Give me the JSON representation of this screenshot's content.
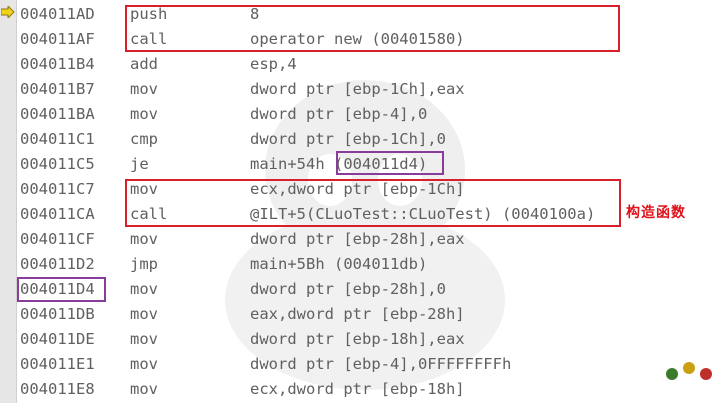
{
  "disassembly": {
    "rows": [
      {
        "addr": "004011AD",
        "op": "push",
        "args": "8"
      },
      {
        "addr": "004011AF",
        "op": "call",
        "args": "operator new (00401580)"
      },
      {
        "addr": "004011B4",
        "op": "add",
        "args": "esp,4"
      },
      {
        "addr": "004011B7",
        "op": "mov",
        "args": "dword ptr [ebp-1Ch],eax"
      },
      {
        "addr": "004011BA",
        "op": "mov",
        "args": "dword ptr [ebp-4],0"
      },
      {
        "addr": "004011C1",
        "op": "cmp",
        "args": "dword ptr [ebp-1Ch],0"
      },
      {
        "addr": "004011C5",
        "op": "je",
        "args": "main+54h (004011d4)"
      },
      {
        "addr": "004011C7",
        "op": "mov",
        "args": "ecx,dword ptr [ebp-1Ch]"
      },
      {
        "addr": "004011CA",
        "op": "call",
        "args": "@ILT+5(CLuoTest::CLuoTest) (0040100a)"
      },
      {
        "addr": "004011CF",
        "op": "mov",
        "args": "dword ptr [ebp-28h],eax"
      },
      {
        "addr": "004011D2",
        "op": "jmp",
        "args": "main+5Bh (004011db)"
      },
      {
        "addr": "004011D4",
        "op": "mov",
        "args": "dword ptr [ebp-28h],0"
      },
      {
        "addr": "004011DB",
        "op": "mov",
        "args": "eax,dword ptr [ebp-28h]"
      },
      {
        "addr": "004011DE",
        "op": "mov",
        "args": "dword ptr [ebp-18h],eax"
      },
      {
        "addr": "004011E1",
        "op": "mov",
        "args": "dword ptr [ebp-4],0FFFFFFFFh"
      },
      {
        "addr": "004011E8",
        "op": "mov",
        "args": "ecx,dword ptr [ebp-18h]"
      }
    ]
  },
  "annotation": "构造函数",
  "colors": {
    "highlight_red": "#d8202a",
    "highlight_purple": "#8a3c9a",
    "current_line_arrow": "#f2d21a",
    "code_text": "#606060"
  },
  "icons": {
    "current_instruction": "instruction-pointer-arrow-icon"
  }
}
